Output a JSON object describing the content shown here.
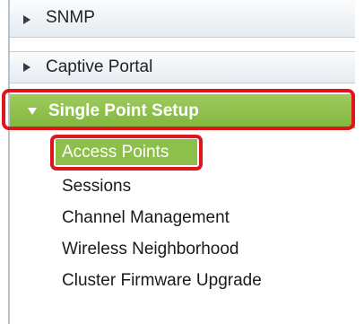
{
  "nav": {
    "sections": [
      {
        "label": "SNMP"
      },
      {
        "label": "Captive Portal"
      }
    ],
    "active_section": {
      "label": "Single Point Setup",
      "items": [
        {
          "label": "Access Points",
          "selected": true
        },
        {
          "label": "Sessions"
        },
        {
          "label": "Channel Management"
        },
        {
          "label": "Wireless Neighborhood"
        },
        {
          "label": "Cluster Firmware Upgrade"
        }
      ]
    }
  },
  "colors": {
    "accent_green": "#8dc04a",
    "highlight_red": "#e0151b",
    "section_bg": "#eef1f4"
  }
}
